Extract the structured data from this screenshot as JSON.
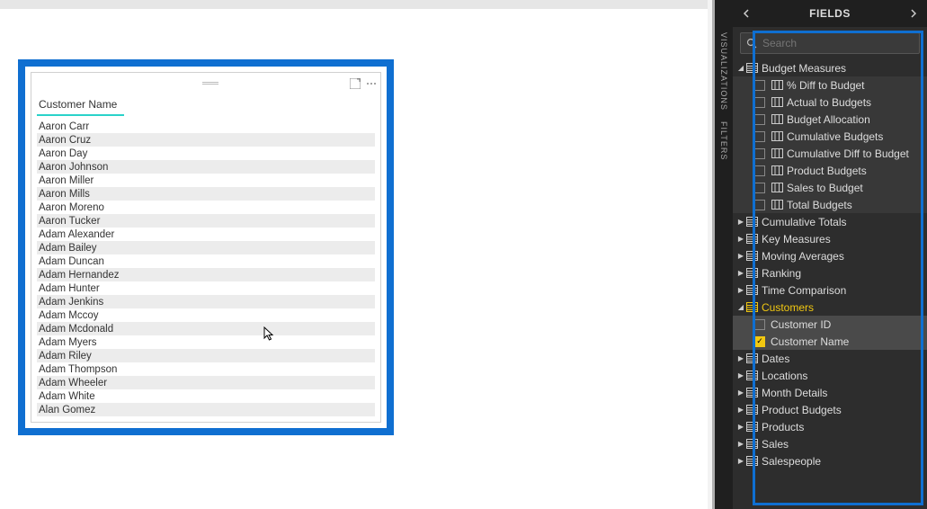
{
  "panel": {
    "title": "FIELDS",
    "rails": [
      "VISUALIZATIONS",
      "FILTERS"
    ],
    "search_placeholder": "Search",
    "tree": [
      {
        "label": "Budget Measures",
        "type": "table",
        "expanded": true,
        "children": [
          {
            "label": "% Diff to Budget",
            "type": "measure",
            "checked": false
          },
          {
            "label": "Actual to Budgets",
            "type": "measure",
            "checked": false
          },
          {
            "label": "Budget Allocation",
            "type": "measure",
            "checked": false
          },
          {
            "label": "Cumulative Budgets",
            "type": "measure",
            "checked": false
          },
          {
            "label": "Cumulative Diff to Budget",
            "type": "measure",
            "checked": false
          },
          {
            "label": "Product Budgets",
            "type": "measure",
            "checked": false
          },
          {
            "label": "Sales to Budget",
            "type": "measure",
            "checked": false
          },
          {
            "label": "Total Budgets",
            "type": "measure",
            "checked": false
          }
        ]
      },
      {
        "label": "Cumulative Totals",
        "type": "table",
        "expanded": false
      },
      {
        "label": "Key Measures",
        "type": "table",
        "expanded": false
      },
      {
        "label": "Moving Averages",
        "type": "table",
        "expanded": false
      },
      {
        "label": "Ranking",
        "type": "table",
        "expanded": false
      },
      {
        "label": "Time Comparison",
        "type": "table",
        "expanded": false
      },
      {
        "label": "Customers",
        "type": "table",
        "expanded": true,
        "active": true,
        "children": [
          {
            "label": "Customer ID",
            "type": "field",
            "checked": false
          },
          {
            "label": "Customer Name",
            "type": "field",
            "checked": true
          }
        ]
      },
      {
        "label": "Dates",
        "type": "table",
        "expanded": false
      },
      {
        "label": "Locations",
        "type": "table",
        "expanded": false
      },
      {
        "label": "Month Details",
        "type": "table",
        "expanded": false
      },
      {
        "label": "Product Budgets",
        "type": "table",
        "expanded": false
      },
      {
        "label": "Products",
        "type": "table",
        "expanded": false
      },
      {
        "label": "Sales",
        "type": "table",
        "expanded": false
      },
      {
        "label": "Salespeople",
        "type": "table",
        "expanded": false
      }
    ]
  },
  "visual": {
    "column_header": "Customer Name",
    "rows": [
      "Aaron Carr",
      "Aaron Cruz",
      "Aaron Day",
      "Aaron Johnson",
      "Aaron Miller",
      "Aaron Mills",
      "Aaron Moreno",
      "Aaron Tucker",
      "Adam Alexander",
      "Adam Bailey",
      "Adam Duncan",
      "Adam Hernandez",
      "Adam Hunter",
      "Adam Jenkins",
      "Adam Mccoy",
      "Adam Mcdonald",
      "Adam Myers",
      "Adam Riley",
      "Adam Thompson",
      "Adam Wheeler",
      "Adam White",
      "Alan Gomez"
    ]
  }
}
